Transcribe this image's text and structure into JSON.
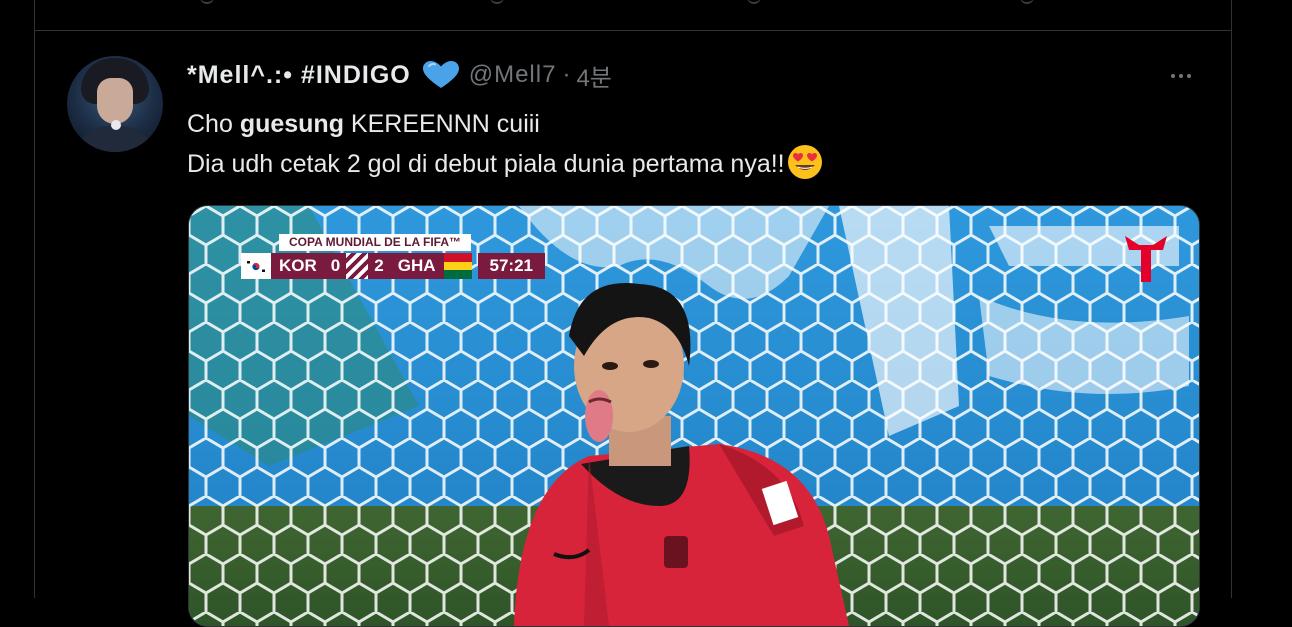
{
  "tweet": {
    "display_name": "*Mell^.:• #INDIGO",
    "handle": "@Mell7",
    "dot": "·",
    "time": "4분",
    "text_line1_prefix": "Cho ",
    "text_line1_bold": "guesung",
    "text_line1_suffix": " KEREENNN cuiii",
    "text_line2": "Dia udh cetak 2 gol di debut piala dunia pertama nya!!",
    "emoji": "smiling-face-with-heart-eyes"
  },
  "media": {
    "scorebug": {
      "title": "COPA MUNDIAL DE LA FIFA™",
      "home_team": "KOR",
      "home_score": "0",
      "away_score": "2",
      "away_team": "GHA",
      "clock": "57:21"
    },
    "broadcaster_logo": "telemundo-logo"
  },
  "colors": {
    "background": "#000000",
    "text_primary": "#e7e9ea",
    "text_secondary": "#71767b",
    "verified_heart": "#4aa3e8",
    "scorebug": "#7a1a3f",
    "jersey": "#d8243a",
    "brand_red": "#e4002b"
  }
}
